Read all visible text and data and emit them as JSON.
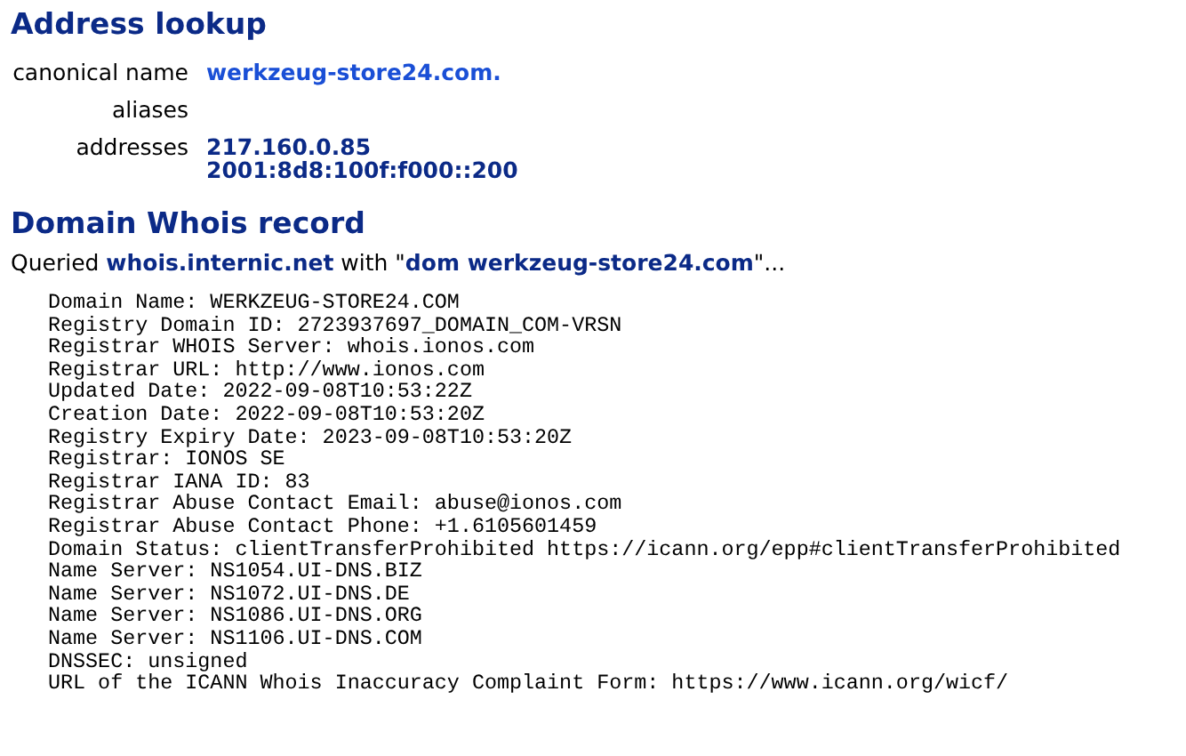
{
  "address_lookup": {
    "title": "Address lookup",
    "rows": [
      {
        "label": "canonical name",
        "kind": "link",
        "values": [
          "werkzeug-store24.com."
        ]
      },
      {
        "label": "aliases"
      },
      {
        "label": "addresses",
        "kind": "address",
        "values": [
          "217.160.0.85",
          "2001:8d8:100f:f000::200"
        ]
      }
    ]
  },
  "whois": {
    "title": "Domain Whois record",
    "query": "Queried **whois.internic.net** with \"**dom werkzeug-store24.com**\"...",
    "lines": [
      "Domain Name: WERKZEUG-STORE24.COM",
      "Registry Domain ID: 2723937697_DOMAIN_COM-VRSN",
      "Registrar WHOIS Server: whois.ionos.com",
      "Registrar URL: http://www.ionos.com",
      "Updated Date: 2022-09-08T10:53:22Z",
      "Creation Date: 2022-09-08T10:53:20Z",
      "Registry Expiry Date: 2023-09-08T10:53:20Z",
      "Registrar: IONOS SE",
      "Registrar IANA ID: 83",
      "Registrar Abuse Contact Email: abuse@ionos.com",
      "Registrar Abuse Contact Phone: +1.6105601459",
      "Domain Status: clientTransferProhibited https://icann.org/epp#clientTransferProhibited",
      "Name Server: NS1054.UI-DNS.BIZ",
      "Name Server: NS1072.UI-DNS.DE",
      "Name Server: NS1086.UI-DNS.ORG",
      "Name Server: NS1106.UI-DNS.COM",
      "DNSSEC: unsigned",
      "URL of the ICANN Whois Inaccuracy Complaint Form: https://www.icann.org/wicf/"
    ]
  }
}
